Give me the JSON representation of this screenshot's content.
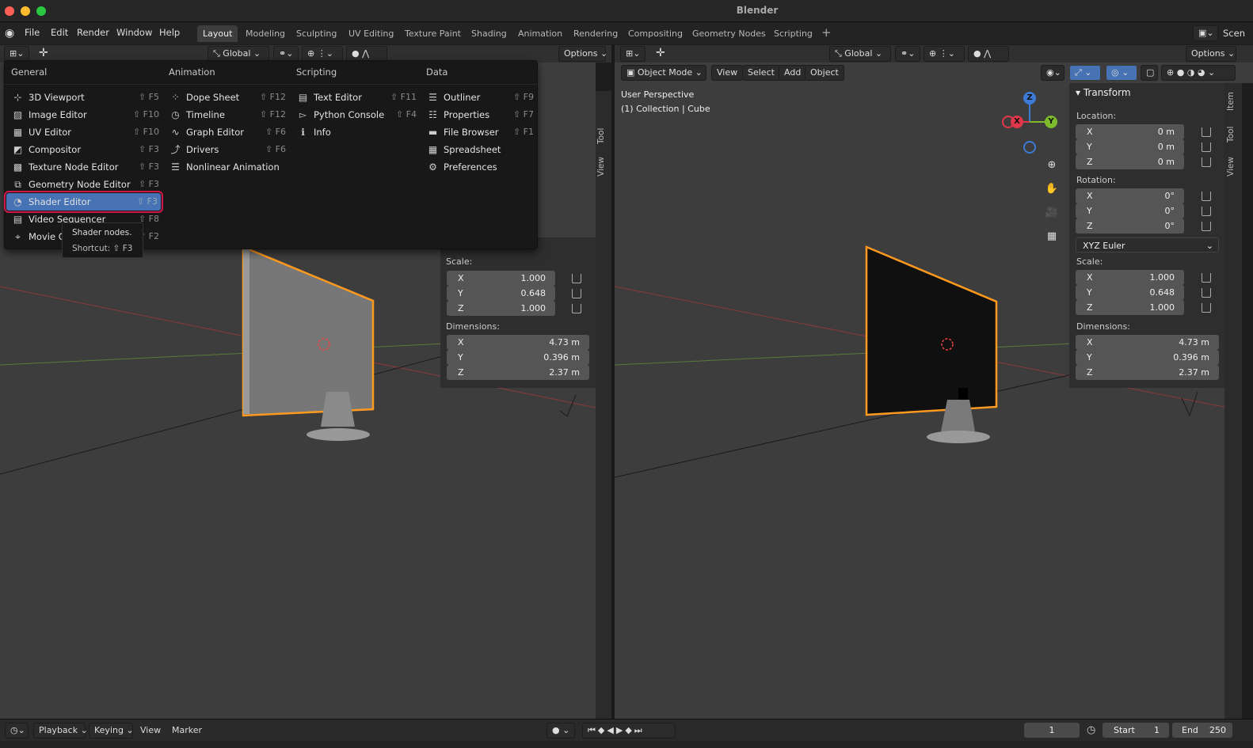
{
  "app": {
    "title": "Blender"
  },
  "menu": [
    "File",
    "Edit",
    "Render",
    "Window",
    "Help"
  ],
  "workspaces": [
    "Layout",
    "Modeling",
    "Sculpting",
    "UV Editing",
    "Texture Paint",
    "Shading",
    "Animation",
    "Rendering",
    "Compositing",
    "Geometry Nodes",
    "Scripting"
  ],
  "scene_label": "Scen",
  "left_header": {
    "orientation": "Global",
    "options": "Options"
  },
  "right_header": {
    "orientation": "Global",
    "options": "Options",
    "mode": "Object Mode",
    "view": "View",
    "select": "Select",
    "add": "Add",
    "object": "Object"
  },
  "viewport_info": {
    "line1": "User Perspective",
    "line2": "(1) Collection | Cube"
  },
  "gizmo": {
    "x": "X",
    "y": "Y",
    "z": "Z"
  },
  "vtabs": [
    "Item",
    "Tool",
    "View"
  ],
  "editor_menu": {
    "columns": [
      {
        "title": "General",
        "items": [
          {
            "label": "3D Viewport",
            "shortcut": "⇧ F5",
            "icon": "viewport-icon"
          },
          {
            "label": "Image Editor",
            "shortcut": "⇧ F10",
            "icon": "image-icon"
          },
          {
            "label": "UV Editor",
            "shortcut": "⇧ F10",
            "icon": "uv-icon"
          },
          {
            "label": "Compositor",
            "shortcut": "⇧ F3",
            "icon": "compositor-icon"
          },
          {
            "label": "Texture Node Editor",
            "shortcut": "⇧ F3",
            "icon": "texture-icon"
          },
          {
            "label": "Geometry Node Editor",
            "shortcut": "⇧ F3",
            "icon": "geometry-icon"
          },
          {
            "label": "Shader Editor",
            "shortcut": "⇧ F3",
            "icon": "shader-icon"
          },
          {
            "label": "Video Sequencer",
            "shortcut": "⇧ F8",
            "icon": "sequencer-icon"
          },
          {
            "label": "Movie Clip Editor",
            "shortcut": "⇧ F2",
            "icon": "clip-icon"
          }
        ]
      },
      {
        "title": "Animation",
        "items": [
          {
            "label": "Dope Sheet",
            "shortcut": "⇧ F12",
            "icon": "dopesheet-icon"
          },
          {
            "label": "Timeline",
            "shortcut": "⇧ F12",
            "icon": "timeline-icon"
          },
          {
            "label": "Graph Editor",
            "shortcut": "⇧ F6",
            "icon": "graph-icon"
          },
          {
            "label": "Drivers",
            "shortcut": "⇧ F6",
            "icon": "drivers-icon"
          },
          {
            "label": "Nonlinear Animation",
            "shortcut": "",
            "icon": "nla-icon"
          }
        ]
      },
      {
        "title": "Scripting",
        "items": [
          {
            "label": "Text Editor",
            "shortcut": "⇧ F11",
            "icon": "text-icon"
          },
          {
            "label": "Python Console",
            "shortcut": "⇧ F4",
            "icon": "console-icon"
          },
          {
            "label": "Info",
            "shortcut": "",
            "icon": "info-icon"
          }
        ]
      },
      {
        "title": "Data",
        "items": [
          {
            "label": "Outliner",
            "shortcut": "⇧ F9",
            "icon": "outliner-icon"
          },
          {
            "label": "Properties",
            "shortcut": "⇧ F7",
            "icon": "properties-icon"
          },
          {
            "label": "File Browser",
            "shortcut": "⇧ F1",
            "icon": "filebrowser-icon"
          },
          {
            "label": "Spreadsheet",
            "shortcut": "",
            "icon": "spreadsheet-icon"
          },
          {
            "label": "Preferences",
            "shortcut": "",
            "icon": "preferences-icon"
          }
        ]
      }
    ],
    "highlighted": "Shader Editor"
  },
  "tooltip": {
    "text": "Shader nodes.",
    "shortcut": "Shortcut: ⇧ F3"
  },
  "transform": {
    "title": "Transform",
    "location_label": "Location:",
    "location": [
      {
        "axis": "X",
        "value": "0 m"
      },
      {
        "axis": "Y",
        "value": "0 m"
      },
      {
        "axis": "Z",
        "value": "0 m"
      }
    ],
    "rotation_label": "Rotation:",
    "rotation": [
      {
        "axis": "X",
        "value": "0°"
      },
      {
        "axis": "Y",
        "value": "0°"
      },
      {
        "axis": "Z",
        "value": "0°"
      }
    ],
    "rotation_mode": "XYZ Euler",
    "scale_label": "Scale:",
    "scale": [
      {
        "axis": "X",
        "value": "1.000"
      },
      {
        "axis": "Y",
        "value": "0.648"
      },
      {
        "axis": "Z",
        "value": "1.000"
      }
    ],
    "dimensions_label": "Dimensions:",
    "dimensions": [
      {
        "axis": "X",
        "value": "4.73 m"
      },
      {
        "axis": "Y",
        "value": "0.396 m"
      },
      {
        "axis": "Z",
        "value": "2.37 m"
      }
    ]
  },
  "timeline": {
    "playback": "Playback",
    "keying": "Keying",
    "view": "View",
    "marker": "Marker",
    "current_frame": "1",
    "start_label": "Start",
    "start": "1",
    "end_label": "End",
    "end": "250"
  },
  "colors": {
    "accent": "#4772b3",
    "selection_outline": "#ff9a1f",
    "highlight_ring": "#d01848"
  }
}
